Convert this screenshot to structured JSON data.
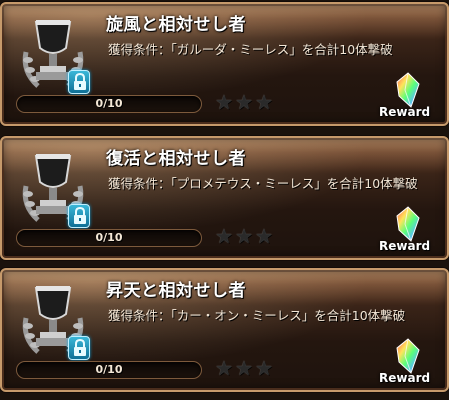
{
  "quests": [
    {
      "title": "旋風と相対せし者",
      "description": "獲得条件：「ガルーダ・ミーレス」を合計10体撃破",
      "progress_text": "0/10",
      "progress_fraction": 0,
      "stars_earned": 0,
      "stars_total": 3,
      "reward_label": "Reward",
      "trophy_icon": "silver-trophy-icon",
      "lock_icon": "lock-icon",
      "reward_icon": "rainbow-crystal-icon"
    },
    {
      "title": "復活と相対せし者",
      "description": "獲得条件：「プロメテウス・ミーレス」を合計10体撃破",
      "progress_text": "0/10",
      "progress_fraction": 0,
      "stars_earned": 0,
      "stars_total": 3,
      "reward_label": "Reward",
      "trophy_icon": "silver-trophy-icon",
      "lock_icon": "lock-icon",
      "reward_icon": "rainbow-crystal-icon"
    },
    {
      "title": "昇天と相対せし者",
      "description": "獲得条件：「カー・オン・ミーレス」を合計10体撃破",
      "progress_text": "0/10",
      "progress_fraction": 0,
      "stars_earned": 0,
      "stars_total": 3,
      "reward_label": "Reward",
      "trophy_icon": "silver-trophy-icon",
      "lock_icon": "lock-icon",
      "reward_icon": "rainbow-crystal-icon"
    }
  ],
  "colors": {
    "panel_border": "#c69a6b",
    "lock_badge": "#1e8fb8",
    "star_empty": "#2a2a2a"
  }
}
